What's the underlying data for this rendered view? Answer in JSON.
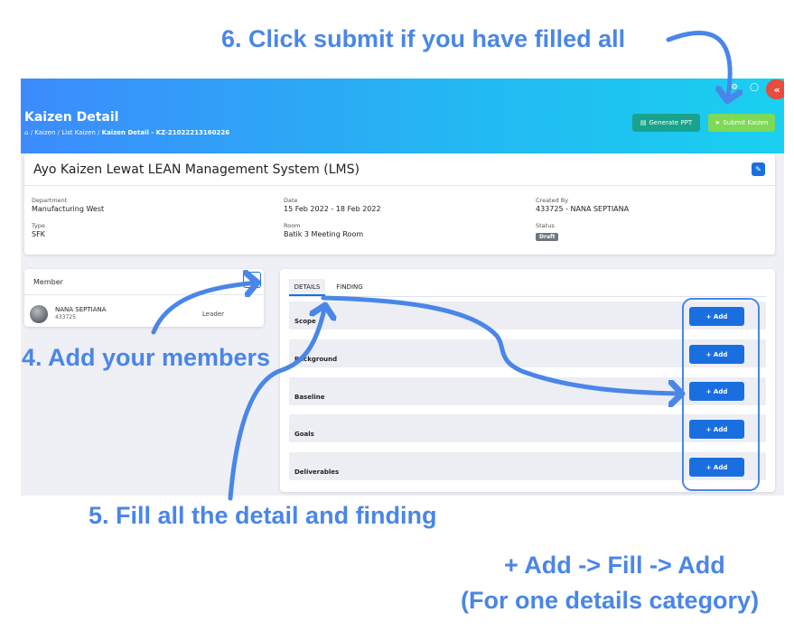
{
  "annotations": {
    "step6": "6. Click submit if you have filled all",
    "step4": "4. Add your members",
    "step5": "5. Fill all the detail and finding",
    "flow_line1": "+ Add -> Fill -> Add",
    "flow_line2": "(For one details category)"
  },
  "colors": {
    "annotation": "#4a86e8",
    "primary": "#1a6fe0",
    "success": "#7ed957",
    "teal": "#1aa38c",
    "draft": "#6c757d"
  },
  "header": {
    "title": "Kaizen Detail",
    "breadcrumb": [
      "Kaizen",
      "List Kaizen",
      "Kaizen Detail - KZ-21022213160226"
    ],
    "generate_ppt": "Generate PPT",
    "submit_kaizen": "Submit Kaizen"
  },
  "kaizen": {
    "title": "Ayo Kaizen Lewat LEAN Management System (LMS)",
    "department_label": "Department",
    "department": "Manufacturing West",
    "date_label": "Date",
    "date": "15 Feb 2022 - 18 Feb 2022",
    "created_by_label": "Created By",
    "created_by": "433725 - NANA SEPTIANA",
    "type_label": "Type",
    "type": "SFK",
    "room_label": "Room",
    "room": "Batik 3 Meeting Room",
    "status_label": "Status",
    "status": "Draft"
  },
  "members": {
    "title": "Member",
    "items": [
      {
        "name": "NANA SEPTIANA",
        "id": "433725",
        "role": "Leader"
      }
    ]
  },
  "details": {
    "tabs": [
      "DETAILS",
      "FINDING"
    ],
    "add_label": "+ Add",
    "rows": [
      "Scope",
      "Background",
      "Baseline",
      "Goals",
      "Deliverables"
    ]
  }
}
